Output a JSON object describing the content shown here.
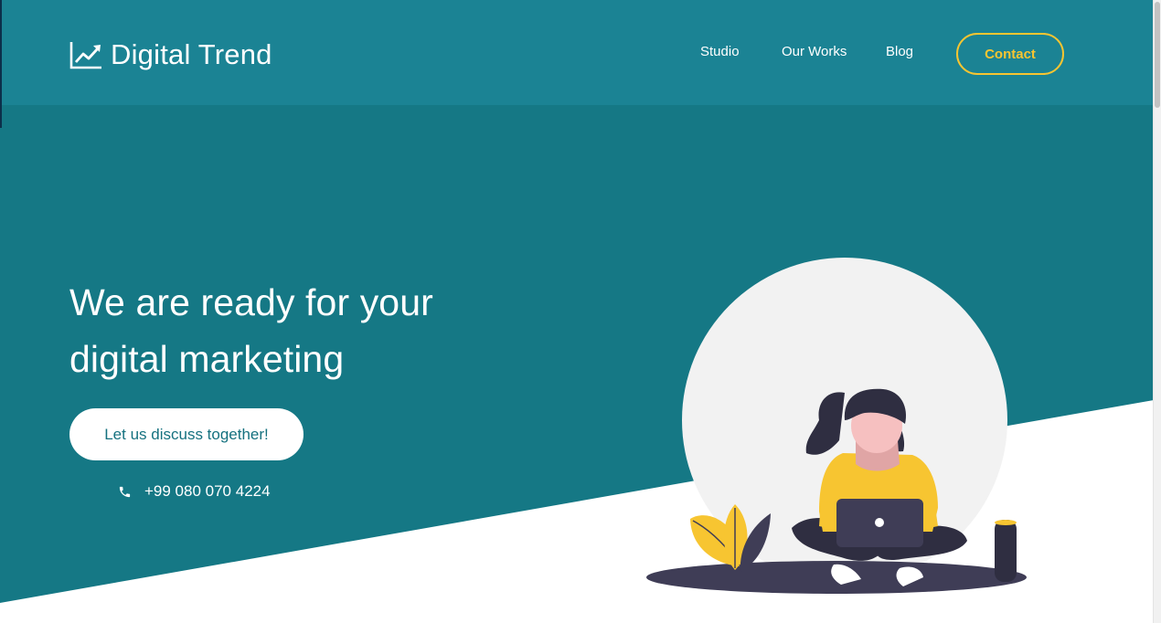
{
  "brand": {
    "name": "Digital Trend",
    "icon": "trending-chart-icon"
  },
  "nav": {
    "items": [
      {
        "label": "Studio"
      },
      {
        "label": "Our Works"
      },
      {
        "label": "Blog"
      }
    ],
    "contact_label": "Contact"
  },
  "hero": {
    "headline_line1": "We are ready for your",
    "headline_line2": "digital marketing",
    "cta_label": "Let us discuss together!",
    "phone": "+99 080 070 4224",
    "phone_icon": "phone-icon",
    "illustration": "woman-with-laptop-illustration"
  },
  "colors": {
    "primary": "#157885",
    "navbar": "#1b8394",
    "accent": "#f7c531",
    "text_light": "#ffffff",
    "illustration_circle": "#f2f2f2",
    "illustration_dark": "#3f3d56"
  }
}
